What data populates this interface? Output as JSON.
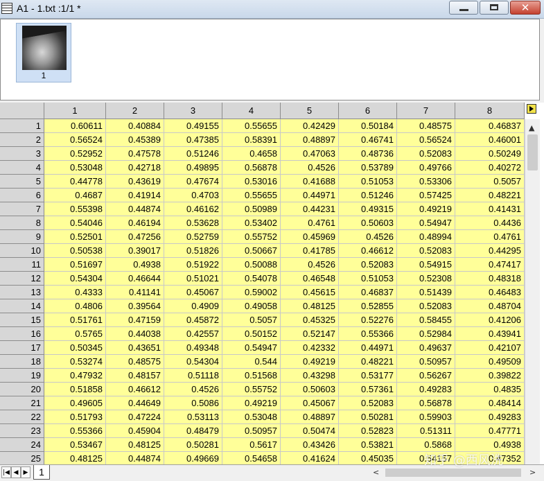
{
  "window": {
    "title": "A1 - 1.txt :1/1  *",
    "minimize_icon": "minimize-icon",
    "maximize_icon": "maximize-icon",
    "close_glyph": "✕"
  },
  "thumbnails": [
    {
      "label": "1",
      "icon": "grayscale-image-thumbnail"
    }
  ],
  "columns": [
    "1",
    "2",
    "3",
    "4",
    "5",
    "6",
    "7",
    "8"
  ],
  "rows": [
    {
      "n": "1",
      "v": [
        "0.60611",
        "0.40884",
        "0.49155",
        "0.55655",
        "0.42429",
        "0.50184",
        "0.48575",
        "0.46837"
      ]
    },
    {
      "n": "2",
      "v": [
        "0.56524",
        "0.45389",
        "0.47385",
        "0.58391",
        "0.48897",
        "0.46741",
        "0.56524",
        "0.46001"
      ]
    },
    {
      "n": "3",
      "v": [
        "0.52952",
        "0.47578",
        "0.51246",
        "0.4658",
        "0.47063",
        "0.48736",
        "0.52083",
        "0.50249"
      ]
    },
    {
      "n": "4",
      "v": [
        "0.53048",
        "0.42718",
        "0.49895",
        "0.56878",
        "0.4526",
        "0.53789",
        "0.49766",
        "0.40272"
      ]
    },
    {
      "n": "5",
      "v": [
        "0.44778",
        "0.43619",
        "0.47674",
        "0.53016",
        "0.41688",
        "0.51053",
        "0.53306",
        "0.5057"
      ]
    },
    {
      "n": "6",
      "v": [
        "0.4687",
        "0.41914",
        "0.4703",
        "0.55655",
        "0.44971",
        "0.51246",
        "0.57425",
        "0.48221"
      ]
    },
    {
      "n": "7",
      "v": [
        "0.55398",
        "0.44874",
        "0.46162",
        "0.50989",
        "0.44231",
        "0.49315",
        "0.49219",
        "0.41431"
      ]
    },
    {
      "n": "8",
      "v": [
        "0.54046",
        "0.46194",
        "0.53628",
        "0.53402",
        "0.4761",
        "0.50603",
        "0.54947",
        "0.4436"
      ]
    },
    {
      "n": "9",
      "v": [
        "0.52501",
        "0.47256",
        "0.52759",
        "0.55752",
        "0.45969",
        "0.4526",
        "0.48994",
        "0.4761"
      ]
    },
    {
      "n": "10",
      "v": [
        "0.50538",
        "0.39017",
        "0.51826",
        "0.50667",
        "0.41785",
        "0.46612",
        "0.52083",
        "0.44295"
      ]
    },
    {
      "n": "11",
      "v": [
        "0.51697",
        "0.4938",
        "0.51922",
        "0.50088",
        "0.4526",
        "0.52083",
        "0.54915",
        "0.47417"
      ]
    },
    {
      "n": "12",
      "v": [
        "0.54304",
        "0.46644",
        "0.51021",
        "0.54078",
        "0.46548",
        "0.51053",
        "0.52308",
        "0.48318"
      ]
    },
    {
      "n": "13",
      "v": [
        "0.4333",
        "0.41141",
        "0.45067",
        "0.59002",
        "0.45615",
        "0.46837",
        "0.51439",
        "0.46483"
      ]
    },
    {
      "n": "14",
      "v": [
        "0.4806",
        "0.39564",
        "0.4909",
        "0.49058",
        "0.48125",
        "0.52855",
        "0.52083",
        "0.48704"
      ]
    },
    {
      "n": "15",
      "v": [
        "0.51761",
        "0.47159",
        "0.45872",
        "0.5057",
        "0.45325",
        "0.52276",
        "0.58455",
        "0.41206"
      ]
    },
    {
      "n": "16",
      "v": [
        "0.5765",
        "0.44038",
        "0.42557",
        "0.50152",
        "0.52147",
        "0.55366",
        "0.52984",
        "0.43941"
      ]
    },
    {
      "n": "17",
      "v": [
        "0.50345",
        "0.43651",
        "0.49348",
        "0.54947",
        "0.42332",
        "0.44971",
        "0.49637",
        "0.42107"
      ]
    },
    {
      "n": "18",
      "v": [
        "0.53274",
        "0.48575",
        "0.54304",
        "0.544",
        "0.49219",
        "0.48221",
        "0.50957",
        "0.49509"
      ]
    },
    {
      "n": "19",
      "v": [
        "0.47932",
        "0.48157",
        "0.51118",
        "0.51568",
        "0.43298",
        "0.53177",
        "0.56267",
        "0.39822"
      ]
    },
    {
      "n": "20",
      "v": [
        "0.51858",
        "0.46612",
        "0.4526",
        "0.55752",
        "0.50603",
        "0.57361",
        "0.49283",
        "0.4835"
      ]
    },
    {
      "n": "21",
      "v": [
        "0.49605",
        "0.44649",
        "0.5086",
        "0.49219",
        "0.45067",
        "0.52083",
        "0.56878",
        "0.48414"
      ]
    },
    {
      "n": "22",
      "v": [
        "0.51793",
        "0.47224",
        "0.53113",
        "0.53048",
        "0.48897",
        "0.50281",
        "0.59903",
        "0.49283"
      ]
    },
    {
      "n": "23",
      "v": [
        "0.55366",
        "0.45904",
        "0.48479",
        "0.50957",
        "0.50474",
        "0.52823",
        "0.51311",
        "0.47771"
      ]
    },
    {
      "n": "24",
      "v": [
        "0.53467",
        "0.48125",
        "0.50281",
        "0.5617",
        "0.43426",
        "0.53821",
        "0.5868",
        "0.4938"
      ]
    },
    {
      "n": "25",
      "v": [
        "0.48125",
        "0.44874",
        "0.49669",
        "0.54658",
        "0.41624",
        "0.45035",
        "0.54157",
        "0.47352"
      ]
    }
  ],
  "sheet_tabs": [
    {
      "label": "1"
    }
  ],
  "nav": {
    "first": "|◀",
    "prev": "◀",
    "next": "▶",
    "last": "▶|"
  },
  "scroll": {
    "up": "▲",
    "left": "<",
    "right": ">"
  },
  "watermark": "知乎 @西风洗",
  "colors": {
    "cell_bg": "#ffff99",
    "header_bg": "#d7d7d7",
    "close_button": "#c4412f"
  }
}
